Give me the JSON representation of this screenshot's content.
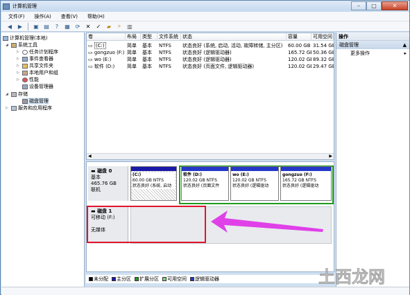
{
  "window": {
    "title": "计算机管理",
    "controls": {
      "minimize": "–",
      "maximize": "□",
      "close": "✕"
    }
  },
  "menu": [
    "文件(F)",
    "操作(A)",
    "查看(V)",
    "帮助(H)"
  ],
  "tree": {
    "root": "计算机管理(本地)",
    "system_tools": "系统工具",
    "children": [
      "任务计划程序",
      "事件查看器",
      "共享文件夹",
      "本地用户和组",
      "性能",
      "设备管理器"
    ],
    "storage": "存储",
    "disk_mgmt": "磁盘管理",
    "services": "服务和应用程序"
  },
  "volumes": {
    "headers": [
      "卷",
      "布局",
      "类型",
      "文件系统",
      "状态",
      "容量",
      "可用空间"
    ],
    "rows": [
      [
        "(C:)",
        "简单",
        "基本",
        "NTFS",
        "状态良好 (系统, 启动, 活动, 故障转储, 主分区)",
        "60.00 GB",
        "31.54 GB"
      ],
      [
        "gongzuo (F:)",
        "简单",
        "基本",
        "NTFS",
        "状态良好 (逻辑驱动器)",
        "165.72 GB",
        "50.36 GB"
      ],
      [
        "wo (E:)",
        "简单",
        "基本",
        "NTFS",
        "状态良好 (逻辑驱动器)",
        "120.02 GB",
        "89.32 GB"
      ],
      [
        "软件 (D:)",
        "简单",
        "基本",
        "NTFS",
        "状态良好 (页面文件, 逻辑驱动器)",
        "120.02 GB",
        "29.47 GB"
      ]
    ]
  },
  "disks": {
    "disk0": {
      "name": "磁盘 0",
      "type": "基本",
      "size": "465.76 GB",
      "status": "联机",
      "partitions": [
        {
          "name": "(C:)",
          "size": "60.00 GB NTFS",
          "status": "状态良好 (系统, 启动"
        },
        {
          "name": "软件 (D:)",
          "size": "120.02 GB NTFS",
          "status": "状态良好 (页面文件"
        },
        {
          "name": "wo (E:)",
          "size": "120.02 GB NTFS",
          "status": "状态良好 (逻辑驱动"
        },
        {
          "name": "gongzuo (F:)",
          "size": "165.72 GB NTFS",
          "status": "状态良好 (逻辑驱动"
        }
      ]
    },
    "disk1": {
      "name": "磁盘 1",
      "type": "可移动 (F:)",
      "status": "无媒体"
    }
  },
  "legend": [
    {
      "label": "未分配",
      "color": "#000000"
    },
    {
      "label": "主分区",
      "color": "#1a1aa8"
    },
    {
      "label": "扩展分区",
      "color": "#1e9a1e"
    },
    {
      "label": "可用空间",
      "color": "#7ed37e"
    },
    {
      "label": "逻辑驱动器",
      "color": "#2438c8"
    }
  ],
  "actions": {
    "header": "操作",
    "section": "磁盘管理",
    "more": "更多操作"
  },
  "watermark": "土西龙网",
  "colors": {
    "annotation": "#e0142a",
    "arrow": "#e040e8",
    "primary_bar": "#1a1aa8",
    "extended_border": "#1e9a1e"
  }
}
